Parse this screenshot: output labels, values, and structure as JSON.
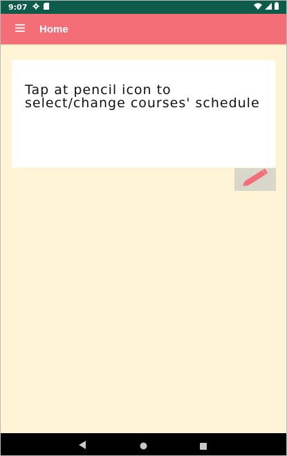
{
  "status_bar": {
    "time": "9:07",
    "left_icons": [
      "settings-gear-icon",
      "sd-card-icon"
    ],
    "right_icons": [
      "wifi-icon",
      "cell-signal-icon",
      "battery-icon"
    ],
    "background": "#0d5b4a"
  },
  "app_bar": {
    "title": "Home",
    "menu_icon": "hamburger-menu-icon",
    "background": "#f46e78"
  },
  "content": {
    "message": "Tap at pencil icon to select/change courses' schedule",
    "background": "#fff4d6",
    "edit_button_icon": "pencil-icon",
    "edit_button_background": "#d7d8c9"
  },
  "nav_bar": {
    "icons": [
      "back-triangle-icon",
      "home-circle-icon",
      "recents-square-icon"
    ]
  }
}
